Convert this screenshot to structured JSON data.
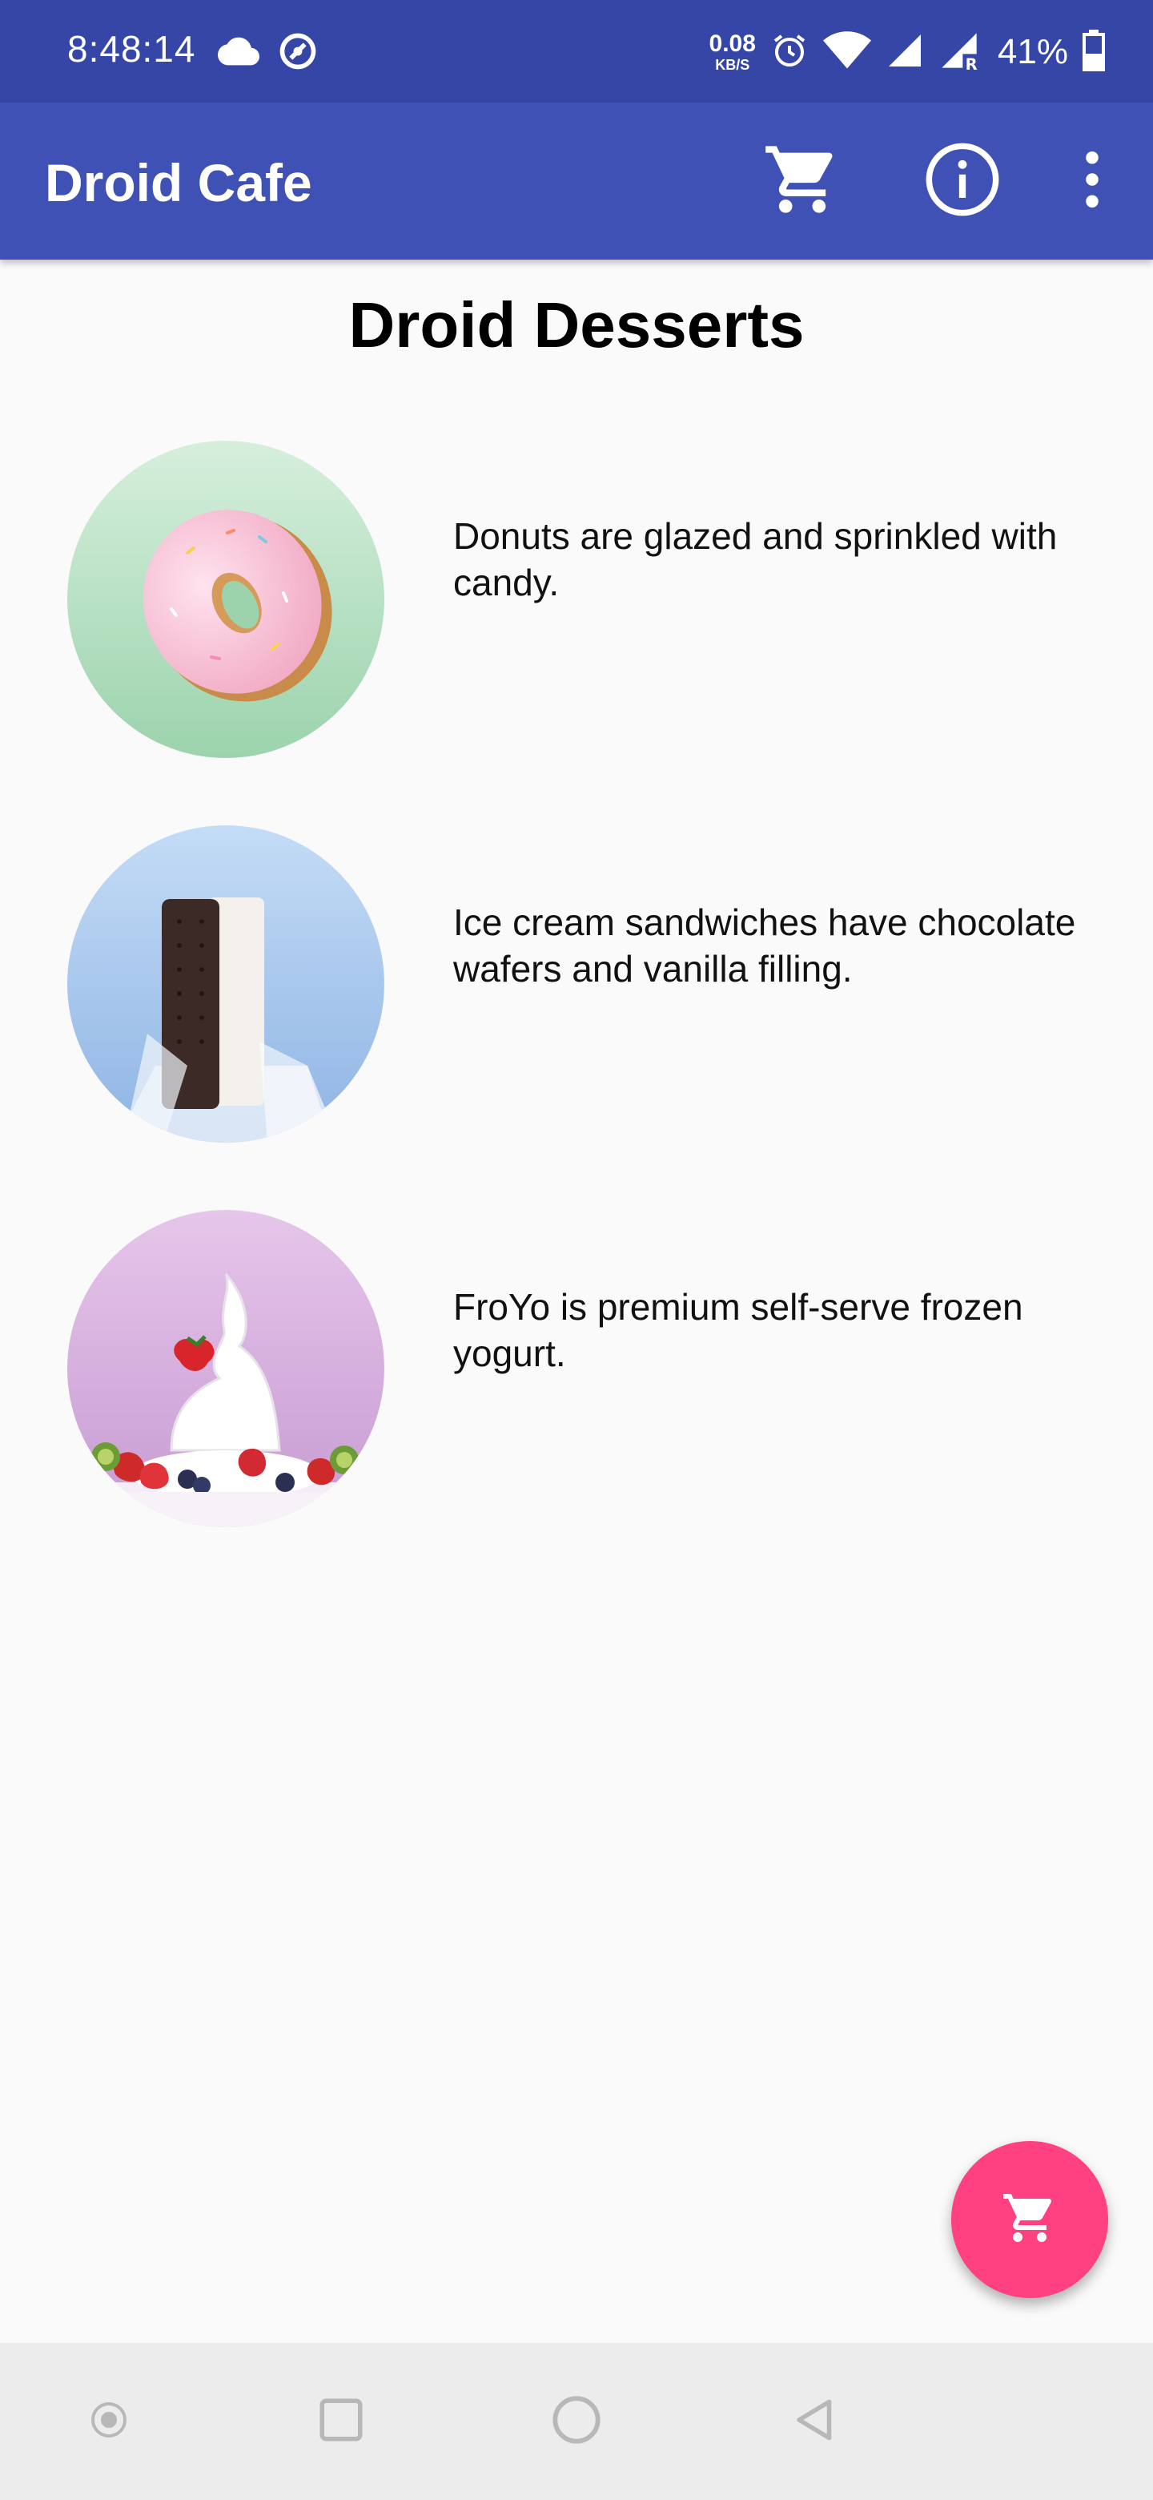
{
  "status_bar": {
    "time": "8:48:14",
    "net_speed_value": "0.08",
    "net_speed_unit": "KB/S",
    "battery_percent": "41%",
    "icons": [
      "cloud-icon",
      "do-not-disturb-icon",
      "alarm-icon",
      "wifi-icon",
      "signal-icon",
      "signal-roaming-icon",
      "battery-icon"
    ]
  },
  "app_bar": {
    "title": "Droid Cafe",
    "actions": [
      "cart-icon",
      "info-icon",
      "overflow-menu-icon"
    ]
  },
  "main": {
    "title": "Droid Desserts",
    "items": [
      {
        "image": "donut-image",
        "description": "Donuts are glazed and sprinkled with candy."
      },
      {
        "image": "ice-cream-sandwich-image",
        "description": "Ice cream sandwiches have chocolate wafers and vanilla filling."
      },
      {
        "image": "froyo-image",
        "description": "FroYo is premium self-serve frozen yogurt."
      }
    ]
  },
  "fab": {
    "icon": "cart-icon"
  },
  "nav_bar": {
    "buttons": [
      "dot-icon",
      "recents-icon",
      "home-icon",
      "back-icon"
    ]
  },
  "colors": {
    "status_bar": "#3646a6",
    "app_bar": "#3f51b5",
    "fab": "#ff4081",
    "background": "#fafafa",
    "nav_bar": "#ececec"
  }
}
